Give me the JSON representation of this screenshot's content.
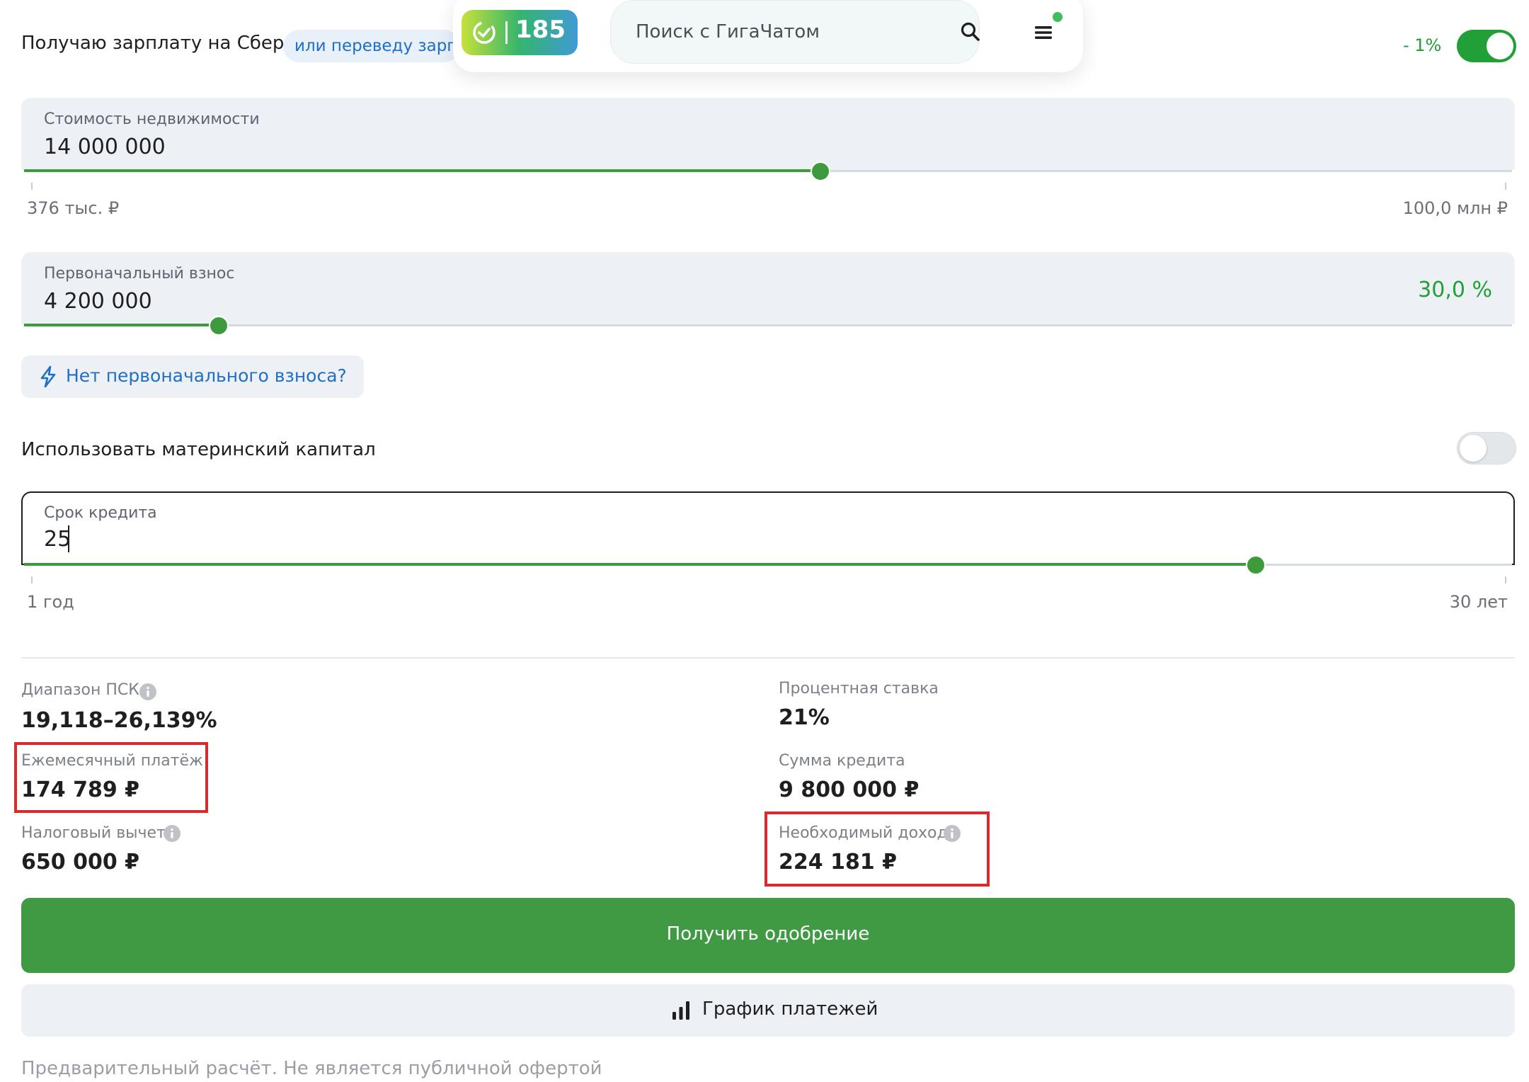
{
  "header": {
    "salary_label": "Получаю зарплату на Сбер",
    "salary_transfer_link": "или переведу зарплату",
    "discount": "- 1%",
    "badge_number": "185",
    "search_placeholder": "Поиск с ГигаЧатом",
    "salary_toggle_on": true
  },
  "property_price": {
    "label": "Стоимость недвижимости",
    "value": "14 000 000",
    "min_label": "376 тыс. ₽",
    "max_label": "100,0 млн ₽",
    "slider_fraction": 0.535
  },
  "down_payment": {
    "label": "Первоначальный взнос",
    "value": "4 200 000",
    "percent": "30,0 %",
    "slider_fraction": 0.131
  },
  "no_down_payment_button": "Нет первоначального взноса?",
  "maternity_capital": {
    "label": "Использовать материнский капитал",
    "enabled": false
  },
  "loan_term": {
    "label": "Срок кредита",
    "value": "25",
    "min_label": "1 год",
    "max_label": "30 лет",
    "slider_fraction": 0.828
  },
  "results": {
    "psk_label": "Диапазон ПСК",
    "psk_value": "19,118–26,139%",
    "rate_label": "Процентная ставка",
    "rate_value": "21%",
    "monthly_label": "Ежемесячный платёж",
    "monthly_value": "174 789 ₽",
    "loan_amount_label": "Сумма кредита",
    "loan_amount_value": "9 800 000 ₽",
    "tax_label": "Налоговый вычет",
    "tax_value": "650 000 ₽",
    "income_label": "Необходимый доход",
    "income_value": "224 181 ₽"
  },
  "buttons": {
    "approve": "Получить одобрение",
    "schedule": "График платежей"
  },
  "disclaimer": "Предварительный расчёт. Не является публичной офертой",
  "colors": {
    "accent_green": "#3f9a43",
    "link_blue": "#1f6fc9",
    "highlight_red": "#d92b2b"
  }
}
